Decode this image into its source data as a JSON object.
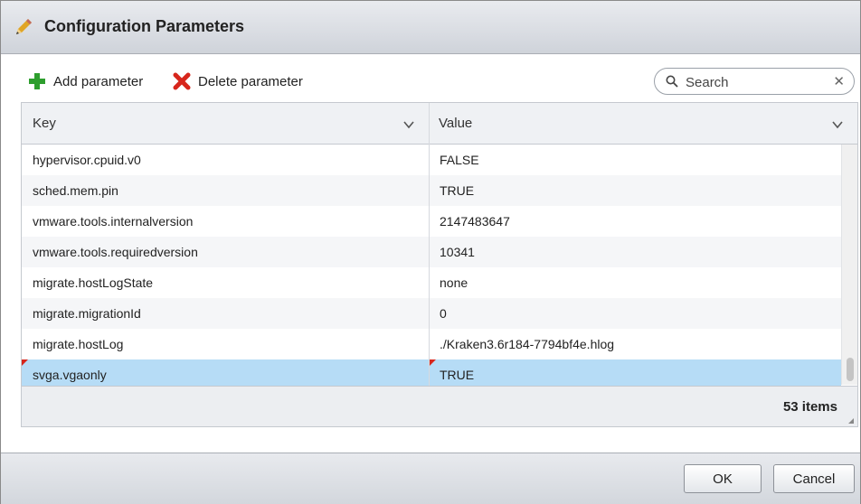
{
  "dialog": {
    "title": "Configuration Parameters",
    "title_icon": "pencil-icon"
  },
  "toolbar": {
    "add_label": "Add parameter",
    "add_icon": "plus-icon",
    "add_icon_color": "#2e9e2e",
    "delete_label": "Delete parameter",
    "delete_icon": "x-icon",
    "delete_icon_color": "#d7261c"
  },
  "search": {
    "placeholder": "Search",
    "icon": "search-icon",
    "clear_icon": "close-icon"
  },
  "grid": {
    "columns": [
      {
        "label": "Key",
        "icon": "chevron-down-icon"
      },
      {
        "label": "Value",
        "icon": "chevron-down-icon"
      }
    ],
    "rows": [
      {
        "key": "hypervisor.cpuid.v0",
        "value": "FALSE"
      },
      {
        "key": "sched.mem.pin",
        "value": "TRUE"
      },
      {
        "key": "vmware.tools.internalversion",
        "value": "2147483647"
      },
      {
        "key": "vmware.tools.requiredversion",
        "value": "10341"
      },
      {
        "key": "migrate.hostLogState",
        "value": "none"
      },
      {
        "key": "migrate.migrationId",
        "value": "0"
      },
      {
        "key": "migrate.hostLog",
        "value": "./Kraken3.6r184-7794bf4e.hlog"
      },
      {
        "key": "svga.vgaonly",
        "value": "TRUE",
        "selected": true,
        "modified": true
      }
    ],
    "item_count": "53 items",
    "selected_color": "#b6dcf6",
    "modified_flag_color": "#d7261c"
  },
  "buttons": {
    "ok": "OK",
    "cancel": "Cancel"
  }
}
